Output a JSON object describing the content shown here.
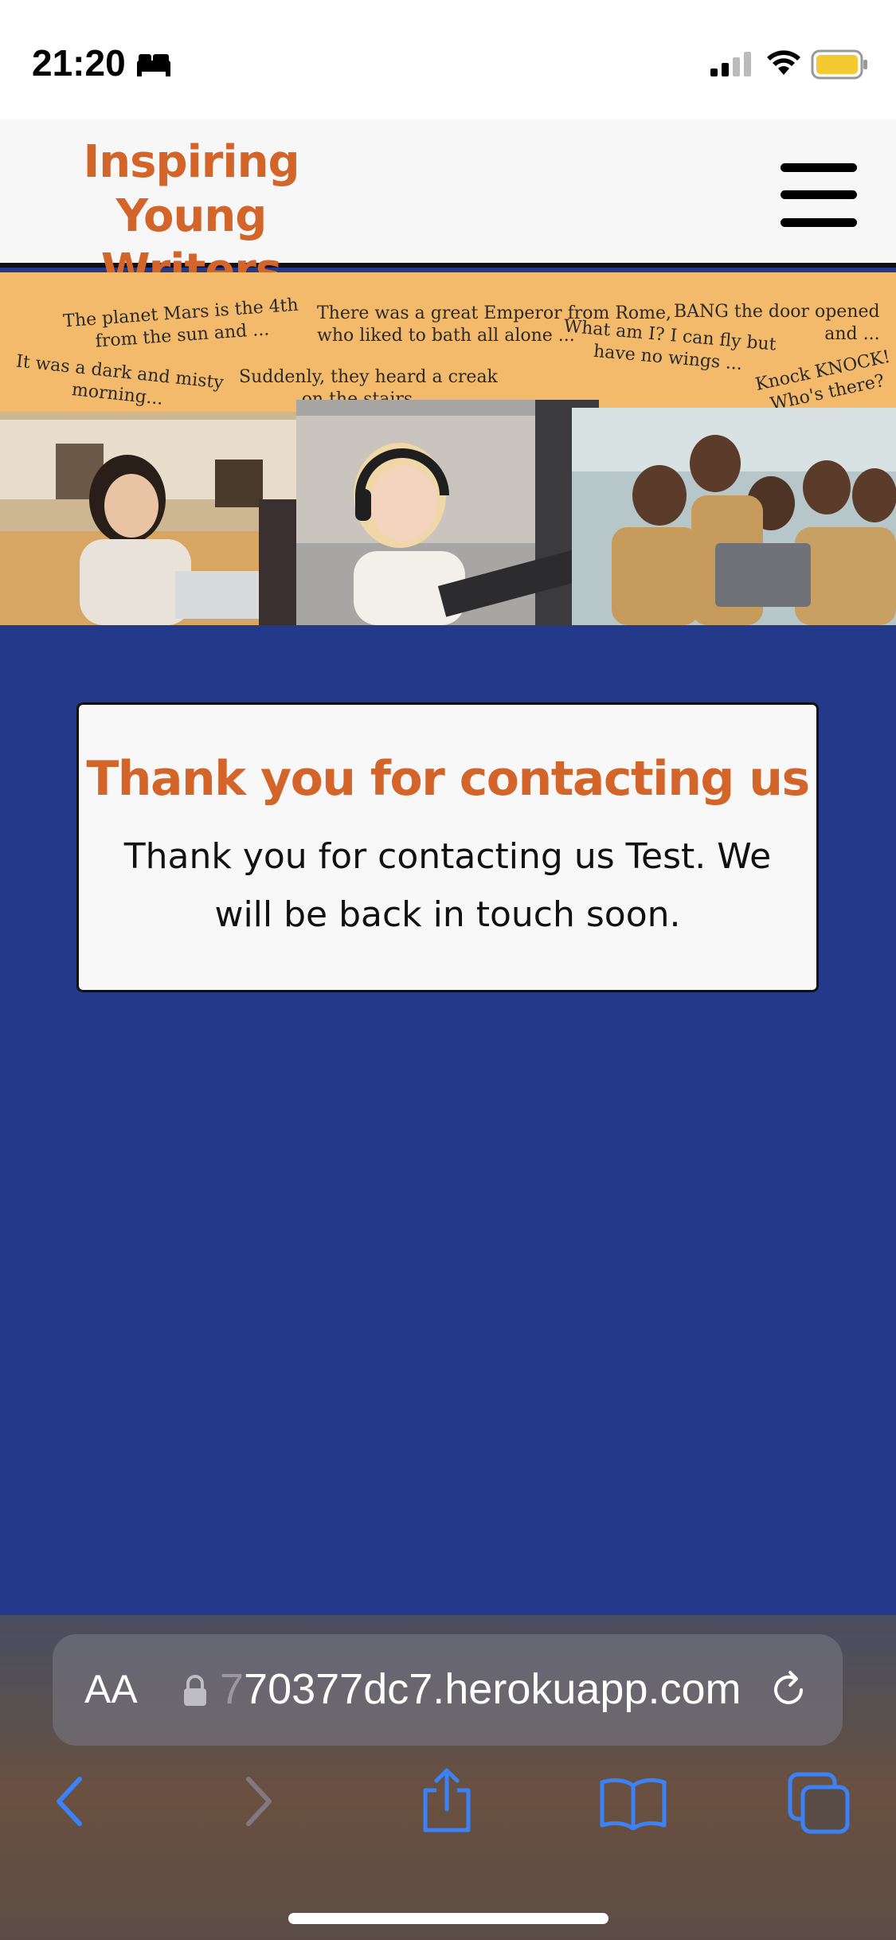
{
  "status_bar": {
    "time": "21:20",
    "icons": [
      "sleep-mode-icon",
      "cellular-signal-icon",
      "wifi-icon",
      "battery-icon"
    ],
    "battery_color": "#f5c932"
  },
  "header": {
    "brand_line1": "Inspiring Young",
    "brand_line2": "Writers",
    "brand_color": "#d4652a",
    "menu_icon": "hamburger-menu-icon"
  },
  "hero": {
    "background_color": "#f2ba6a",
    "quotes": [
      "The planet Mars is the 4th\nfrom the sun and ...",
      "It was a dark and misty\nmorning...",
      "There was a great Emperor from Rome,\nwho liked to bath all alone ...",
      "Suddenly, they heard a creak\non the stairs ...",
      "What am I? I can fly but\nhave no wings ...",
      "BANG the door opened\nand ...",
      "Knock KNOCK!\nWho's there?"
    ]
  },
  "card": {
    "title": "Thank you for contacting us",
    "message": "Thank you for contacting us Test. We will be back in touch soon."
  },
  "browser": {
    "text_size_label": "AA",
    "url": "70377dc7.herokuapp.com",
    "url_prefix_partial": "7",
    "toolbar": [
      "back-icon",
      "forward-icon",
      "share-icon",
      "bookmarks-icon",
      "tabs-icon"
    ],
    "accent": "#3b82f6"
  },
  "page_background": "#23398a"
}
